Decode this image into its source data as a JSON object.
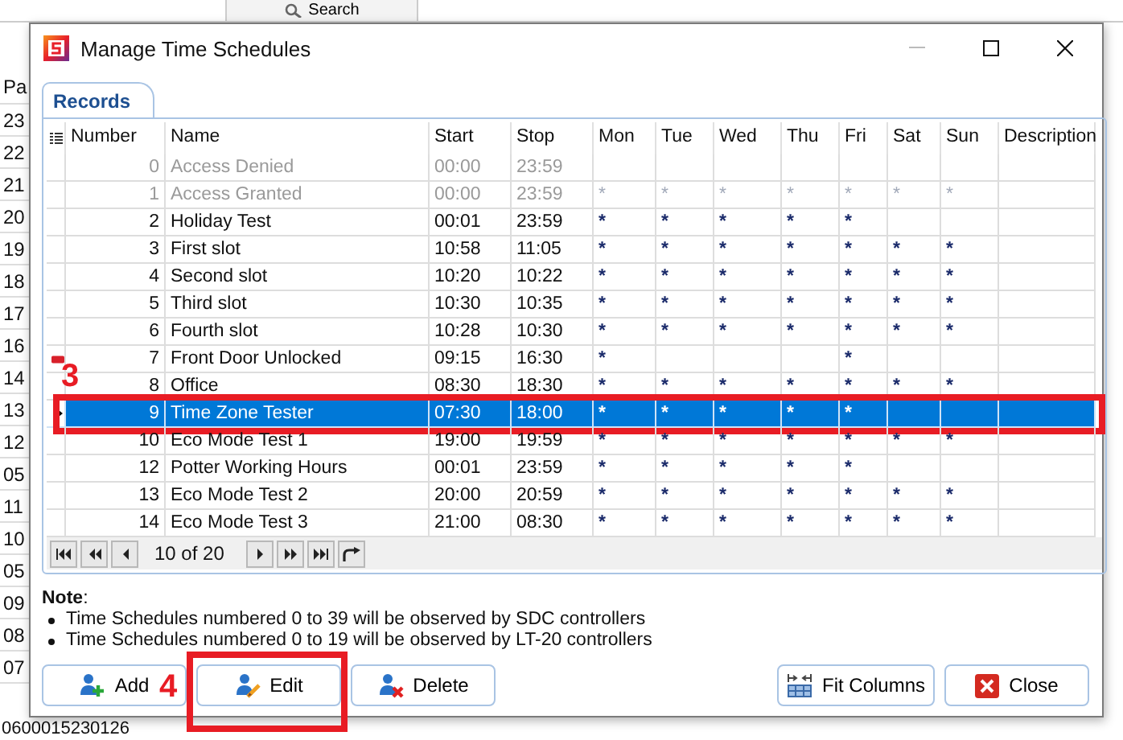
{
  "background": {
    "search_button": "Search",
    "column_header": "Pa",
    "column_values": [
      "23",
      "22",
      "21",
      "20",
      "19",
      "18",
      "17",
      "16",
      "14",
      "13",
      "12",
      "05",
      "11",
      "10",
      "05",
      "09",
      "08",
      "07"
    ],
    "footer_value": "0600015230126"
  },
  "window": {
    "title": "Manage Time Schedules"
  },
  "tabs": [
    {
      "label": "Records",
      "selected": true
    }
  ],
  "table": {
    "columns": [
      "Number",
      "Name",
      "Start",
      "Stop",
      "Mon",
      "Tue",
      "Wed",
      "Thu",
      "Fri",
      "Sat",
      "Sun",
      "Description"
    ],
    "rows": [
      {
        "number": "0",
        "name": "Access Denied",
        "start": "00:00",
        "stop": "23:59",
        "days": {},
        "disabled": true,
        "selected": false,
        "flagged": false
      },
      {
        "number": "1",
        "name": "Access Granted",
        "start": "00:00",
        "stop": "23:59",
        "days": {
          "mon": "*",
          "tue": "*",
          "wed": "*",
          "thu": "*",
          "fri": "*",
          "sat": "*",
          "sun": "*"
        },
        "disabled": true,
        "selected": false,
        "flagged": false
      },
      {
        "number": "2",
        "name": "Holiday Test",
        "start": "00:01",
        "stop": "23:59",
        "days": {
          "mon": "*",
          "tue": "*",
          "wed": "*",
          "thu": "*",
          "fri": "*"
        },
        "disabled": false,
        "selected": false,
        "flagged": false
      },
      {
        "number": "3",
        "name": "First slot",
        "start": "10:58",
        "stop": "11:05",
        "days": {
          "mon": "*",
          "tue": "*",
          "wed": "*",
          "thu": "*",
          "fri": "*",
          "sat": "*",
          "sun": "*"
        },
        "disabled": false,
        "selected": false,
        "flagged": false
      },
      {
        "number": "4",
        "name": "Second slot",
        "start": "10:20",
        "stop": "10:22",
        "days": {
          "mon": "*",
          "tue": "*",
          "wed": "*",
          "thu": "*",
          "fri": "*",
          "sat": "*",
          "sun": "*"
        },
        "disabled": false,
        "selected": false,
        "flagged": false
      },
      {
        "number": "5",
        "name": "Third slot",
        "start": "10:30",
        "stop": "10:35",
        "days": {
          "mon": "*",
          "tue": "*",
          "wed": "*",
          "thu": "*",
          "fri": "*",
          "sat": "*",
          "sun": "*"
        },
        "disabled": false,
        "selected": false,
        "flagged": false
      },
      {
        "number": "6",
        "name": "Fourth slot",
        "start": "10:28",
        "stop": "10:30",
        "days": {
          "mon": "*",
          "tue": "*",
          "wed": "*",
          "thu": "*",
          "fri": "*",
          "sat": "*",
          "sun": "*"
        },
        "disabled": false,
        "selected": false,
        "flagged": false
      },
      {
        "number": "7",
        "name": "Front Door Unlocked",
        "start": "09:15",
        "stop": "16:30",
        "days": {
          "mon": "*",
          "fri": "*"
        },
        "disabled": false,
        "selected": false,
        "flagged": true
      },
      {
        "number": "8",
        "name": "Office",
        "start": "08:30",
        "stop": "18:30",
        "days": {
          "mon": "*",
          "tue": "*",
          "wed": "*",
          "thu": "*",
          "fri": "*",
          "sat": "*",
          "sun": "*"
        },
        "disabled": false,
        "selected": false,
        "flagged": false
      },
      {
        "number": "9",
        "name": "Time Zone Tester",
        "start": "07:30",
        "stop": "18:00",
        "days": {
          "mon": "*",
          "tue": "*",
          "wed": "*",
          "thu": "*",
          "fri": "*"
        },
        "disabled": false,
        "selected": true,
        "flagged": false
      },
      {
        "number": "10",
        "name": "Eco Mode Test 1",
        "start": "19:00",
        "stop": "19:59",
        "days": {
          "mon": "*",
          "tue": "*",
          "wed": "*",
          "thu": "*",
          "fri": "*",
          "sat": "*",
          "sun": "*"
        },
        "disabled": false,
        "selected": false,
        "flagged": false
      },
      {
        "number": "12",
        "name": "Potter Working Hours",
        "start": "00:01",
        "stop": "23:59",
        "days": {
          "mon": "*",
          "tue": "*",
          "wed": "*",
          "thu": "*",
          "fri": "*"
        },
        "disabled": false,
        "selected": false,
        "flagged": false
      },
      {
        "number": "13",
        "name": "Eco Mode Test 2",
        "start": "20:00",
        "stop": "20:59",
        "days": {
          "mon": "*",
          "tue": "*",
          "wed": "*",
          "thu": "*",
          "fri": "*",
          "sat": "*",
          "sun": "*"
        },
        "disabled": false,
        "selected": false,
        "flagged": false
      },
      {
        "number": "14",
        "name": "Eco Mode Test 3",
        "start": "21:00",
        "stop": "08:30",
        "days": {
          "mon": "*",
          "tue": "*",
          "wed": "*",
          "thu": "*",
          "fri": "*",
          "sat": "*",
          "sun": "*"
        },
        "disabled": false,
        "selected": false,
        "flagged": false
      }
    ]
  },
  "pager": {
    "position": "10 of 20"
  },
  "note": {
    "title": "**Note**:",
    "items": [
      "Time Schedules numbered 0 to 39 will be observed by SDC controllers",
      "Time Schedules numbered 0 to 19 will be observed by LT-20 controllers"
    ]
  },
  "left_buttons": [
    {
      "label": "Add",
      "kind": "add"
    },
    {
      "label": "Edit",
      "kind": "edit"
    },
    {
      "label": "Delete",
      "kind": "delete"
    }
  ],
  "right_buttons": [
    {
      "label": "Fit Columns",
      "kind": "fit"
    },
    {
      "label": "Close",
      "kind": "close"
    }
  ],
  "annotations": [
    {
      "label": "3",
      "kind": "row"
    },
    {
      "label": "4",
      "kind": "button"
    }
  ]
}
